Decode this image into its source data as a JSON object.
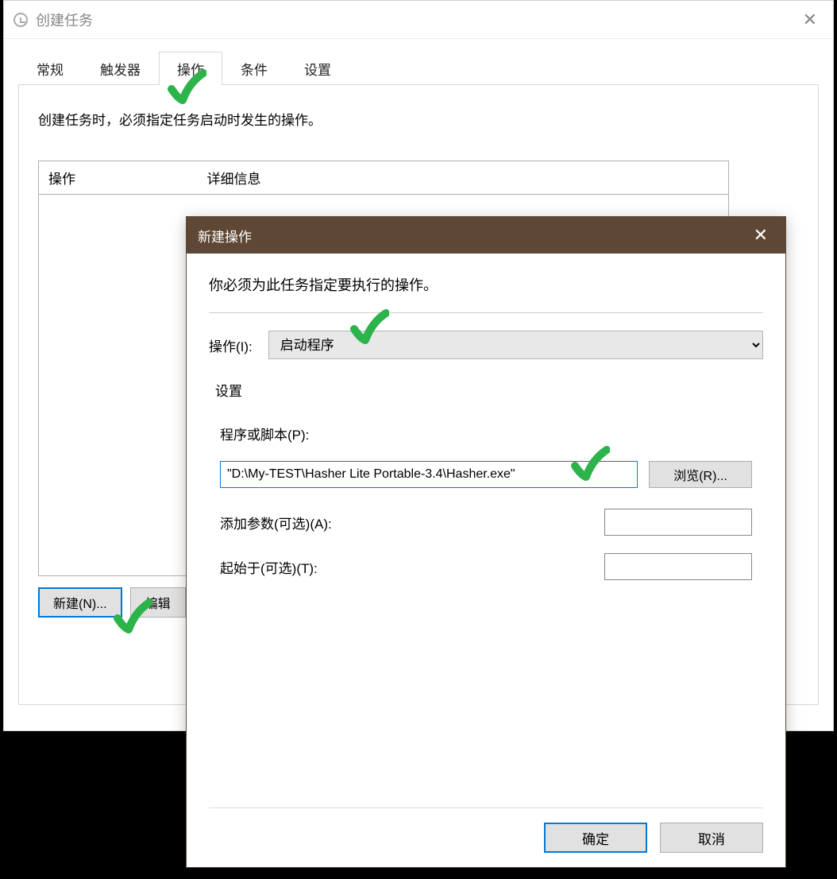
{
  "parent": {
    "title": "创建任务",
    "tabs": [
      "常规",
      "触发器",
      "操作",
      "条件",
      "设置"
    ],
    "active_tab_index": 2,
    "description": "创建任务时，必须指定任务启动时发生的操作。",
    "columns": {
      "action": "操作",
      "details": "详细信息"
    },
    "buttons": {
      "new": "新建(N)...",
      "edit": "编辑"
    }
  },
  "child": {
    "title": "新建操作",
    "description": "你必须为此任务指定要执行的操作。",
    "action_label": "操作(I):",
    "action_value": "启动程序",
    "settings_legend": "设置",
    "program_label": "程序或脚本(P):",
    "program_value": "\"D:\\My-TEST\\Hasher Lite Portable-3.4\\Hasher.exe\"",
    "browse": "浏览(R)...",
    "args_label": "添加参数(可选)(A):",
    "args_value": "",
    "startin_label": "起始于(可选)(T):",
    "startin_value": "",
    "ok": "确定",
    "cancel": "取消"
  }
}
